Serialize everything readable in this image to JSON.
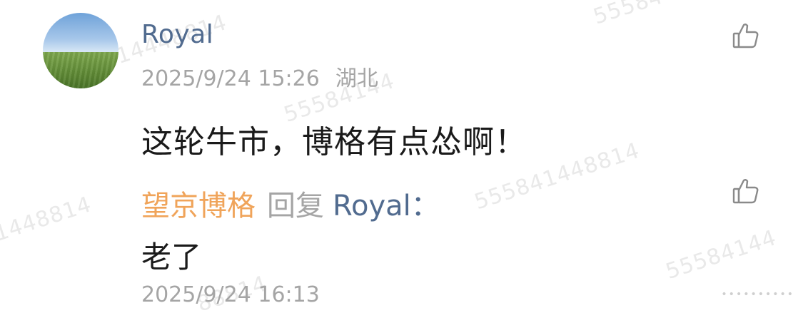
{
  "comment": {
    "username": "Royal",
    "timestamp": "2025/9/24 15:26",
    "location": "湖北",
    "text": "这轮牛市，博格有点怂啊！",
    "like_icon": "thumbs-up-icon",
    "avatar_icon": "avatar-landscape"
  },
  "reply": {
    "author": "望京博格",
    "reply_word": "回复",
    "target": "Royal",
    "colon": "：",
    "text": "老了",
    "timestamp": "2025/9/24 16:13",
    "like_icon": "thumbs-up-icon"
  },
  "watermark": {
    "text_a": "55584",
    "text_b": "14448814",
    "text_c": "55584144",
    "text_d": "55584144",
    "text_e": "555841448814",
    "text_f": "1448814",
    "text_g": "555841448814",
    "text_h": "88814"
  },
  "colors": {
    "username": "#516b8f",
    "reply_author": "#f0a45a",
    "meta": "#a5a5a5",
    "text": "#1a1a1a"
  },
  "more_indicator": "••••••••••"
}
